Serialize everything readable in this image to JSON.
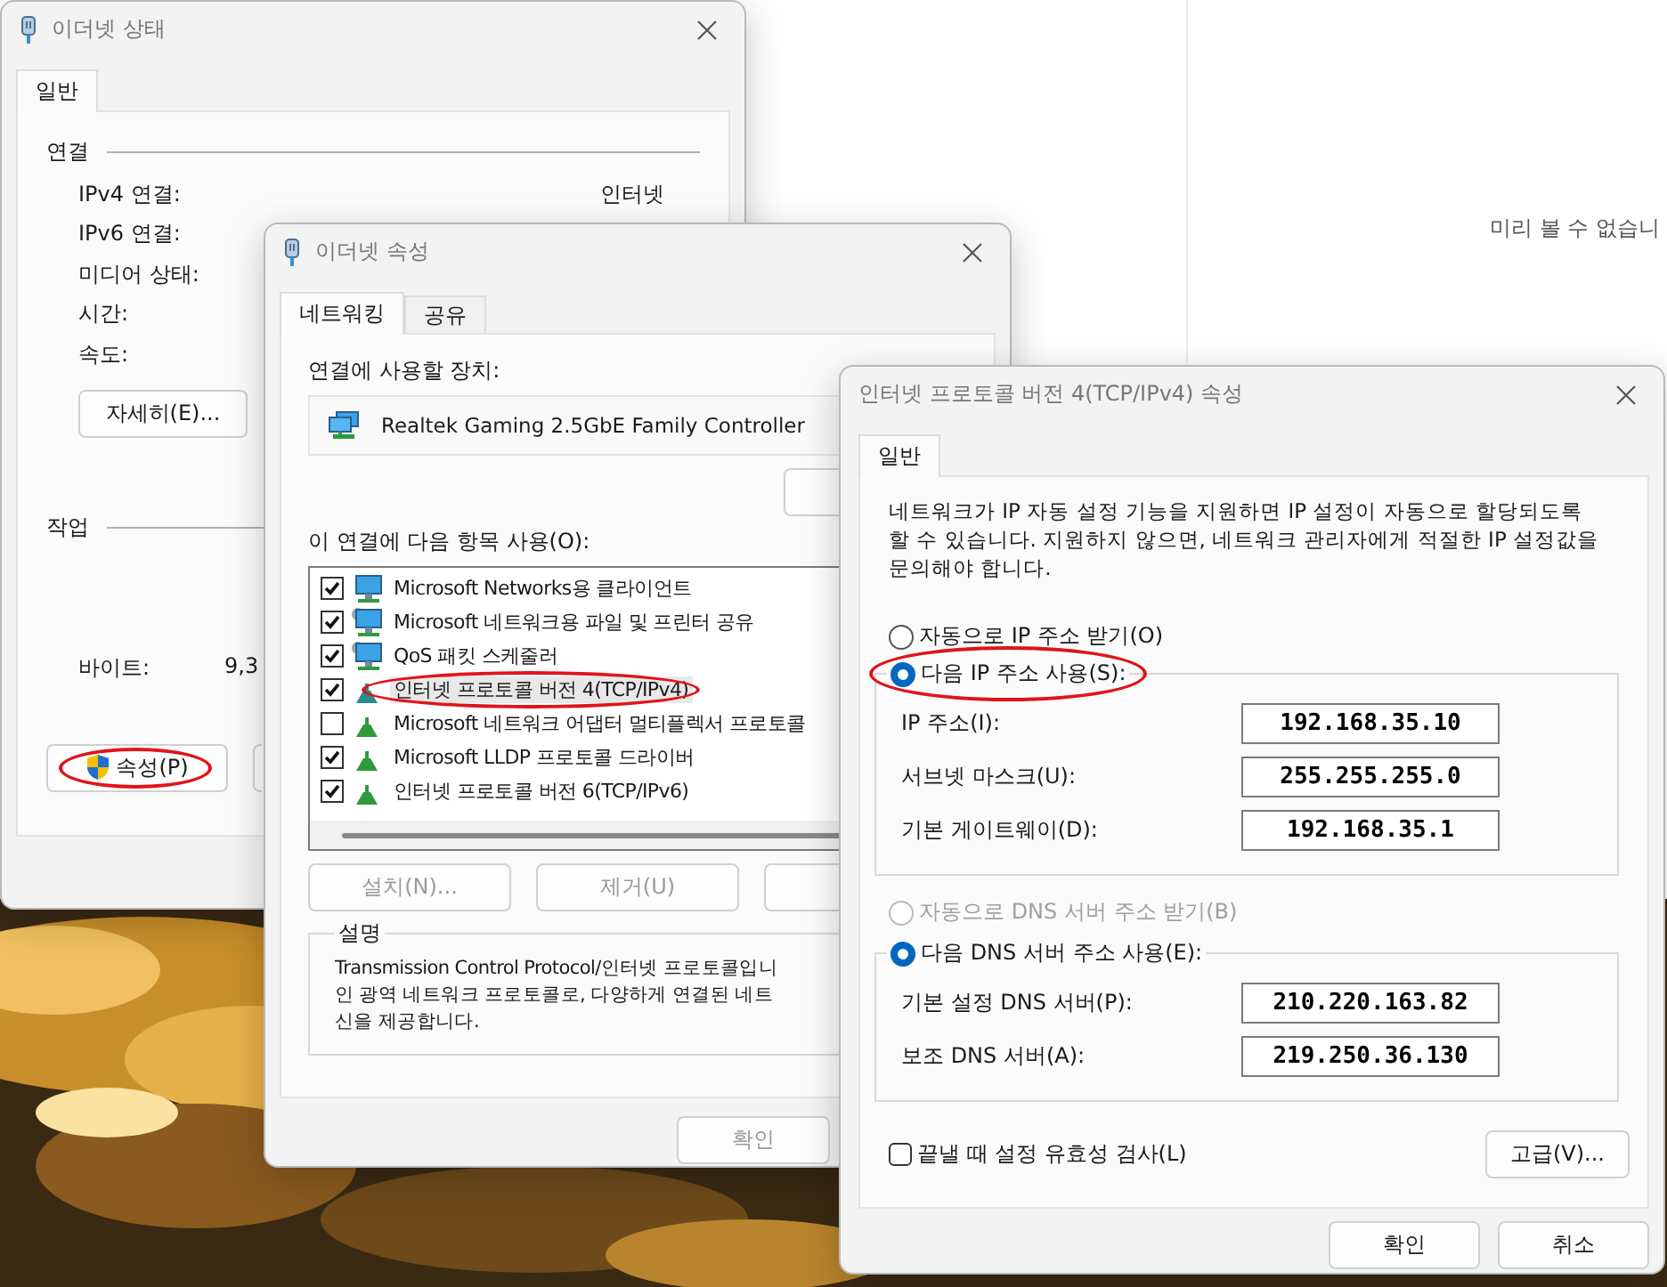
{
  "desktop": {
    "preview_text": "미리 볼 수 없습니"
  },
  "status_window": {
    "title": "이더넷 상태",
    "tabs": [
      {
        "label": "일반",
        "selected": true
      }
    ],
    "connection": {
      "heading": "연결",
      "rows": [
        {
          "label": "IPv4 연결:",
          "value": "인터넷"
        },
        {
          "label": "IPv6 연결:"
        },
        {
          "label": "미디어 상태:"
        },
        {
          "label": "시간:"
        },
        {
          "label": "속도:"
        }
      ]
    },
    "details_button": "자세히(E)...",
    "activity": {
      "heading": "작업",
      "bytes_label": "바이트:",
      "bytes_value": "9,3"
    },
    "properties_button": {
      "label": "속성(P)",
      "shield": true,
      "circled": true
    }
  },
  "properties_window": {
    "title": "이더넷 속성",
    "tabs": [
      {
        "label": "네트워킹",
        "selected": true
      },
      {
        "label": "공유",
        "selected": false
      }
    ],
    "device_label": "연결에 사용할 장치:",
    "device_name": "Realtek Gaming 2.5GbE Family Controller",
    "components_label": "이 연결에 다음 항목 사용(O):",
    "components": [
      {
        "label": "Microsoft Networks용 클라이언트",
        "checked": true,
        "selected": false,
        "circled": false,
        "kind": "client"
      },
      {
        "label": "Microsoft 네트워크용 파일 및 프린터 공유",
        "checked": true,
        "selected": false,
        "circled": false,
        "kind": "service"
      },
      {
        "label": "QoS 패킷 스케줄러",
        "checked": true,
        "selected": false,
        "circled": false,
        "kind": "service"
      },
      {
        "label": "인터넷 프로토콜 버전 4(TCP/IPv4)",
        "checked": true,
        "selected": true,
        "circled": true,
        "kind": "protocol"
      },
      {
        "label": "Microsoft 네트워크 어댑터 멀티플렉서 프로토콜",
        "checked": false,
        "selected": false,
        "circled": false,
        "kind": "protocol"
      },
      {
        "label": "Microsoft LLDP 프로토콜 드라이버",
        "checked": true,
        "selected": false,
        "circled": false,
        "kind": "protocol"
      },
      {
        "label": "인터넷 프로토콜 버전 6(TCP/IPv6)",
        "checked": true,
        "selected": false,
        "circled": false,
        "kind": "protocol"
      }
    ],
    "buttons": [
      {
        "label": "설치(N)...",
        "disabled": true
      },
      {
        "label": "제거(U)",
        "disabled": true
      }
    ],
    "description": {
      "heading": "설명",
      "lines": [
        "Transmission Control Protocol/인터넷 프로토콜입니",
        "인 광역 네트워크 프로토콜로, 다양하게 연결된 네트",
        "신을 제공합니다."
      ]
    },
    "ok_button": {
      "label": "확인",
      "disabled": true
    }
  },
  "ipv4_window": {
    "title": "인터넷 프로토콜 버전 4(TCP/IPv4) 속성",
    "tabs": [
      {
        "label": "일반",
        "selected": true
      }
    ],
    "intro_lines": [
      "네트워크가 IP 자동 설정 기능을 지원하면 IP 설정이 자동으로 할당되도록",
      "할 수 있습니다. 지원하지 않으면, 네트워크 관리자에게 적절한 IP 설정값을",
      "문의해야 합니다."
    ],
    "ip_options": [
      {
        "label": "자동으로 IP 주소 받기(O)",
        "selected": false,
        "disabled": false,
        "circled": false
      },
      {
        "label": "다음 IP 주소 사용(S):",
        "selected": true,
        "disabled": false,
        "circled": true
      }
    ],
    "ip_fields": [
      {
        "label": "IP 주소(I):",
        "value": "192.168.35.10"
      },
      {
        "label": "서브넷 마스크(U):",
        "value": "255.255.255.0"
      },
      {
        "label": "기본 게이트웨이(D):",
        "value": "192.168.35.1"
      }
    ],
    "dns_options": [
      {
        "label": "자동으로 DNS 서버 주소 받기(B)",
        "selected": false,
        "disabled": true,
        "circled": false
      },
      {
        "label": "다음 DNS 서버 주소 사용(E):",
        "selected": true,
        "disabled": false,
        "circled": false
      }
    ],
    "dns_fields": [
      {
        "label": "기본 설정 DNS 서버(P):",
        "value": "210.220.163.82"
      },
      {
        "label": "보조 DNS 서버(A):",
        "value": "219.250.36.130"
      }
    ],
    "validate": {
      "label": "끝낼 때 설정 유효성 검사(L)",
      "checked": false
    },
    "advanced_button": "고급(V)...",
    "buttons": [
      "확인",
      "취소"
    ]
  }
}
